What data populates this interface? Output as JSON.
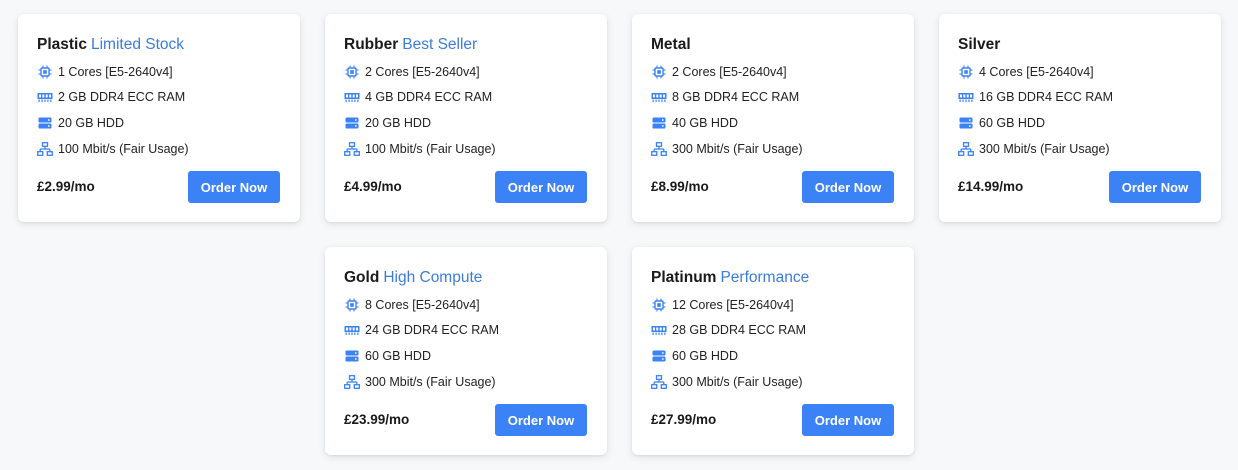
{
  "accent_color": "#3b82f6",
  "tag_color": "#3b7ddd",
  "plans": [
    {
      "name": "Plastic",
      "tag": "Limited Stock",
      "cpu": "1 Cores [E5-2640v4]",
      "ram": "2 GB DDR4 ECC RAM",
      "disk": "20 GB HDD",
      "network": "100 Mbit/s (Fair Usage)",
      "price": "£2.99/mo",
      "button": "Order Now"
    },
    {
      "name": "Rubber",
      "tag": "Best Seller",
      "cpu": "2 Cores [E5-2640v4]",
      "ram": "4 GB DDR4 ECC RAM",
      "disk": "20 GB HDD",
      "network": "100 Mbit/s (Fair Usage)",
      "price": "£4.99/mo",
      "button": "Order Now"
    },
    {
      "name": "Metal",
      "tag": "",
      "cpu": "2 Cores [E5-2640v4]",
      "ram": "8 GB DDR4 ECC RAM",
      "disk": "40 GB HDD",
      "network": "300 Mbit/s (Fair Usage)",
      "price": "£8.99/mo",
      "button": "Order Now"
    },
    {
      "name": "Silver",
      "tag": "",
      "cpu": "4 Cores [E5-2640v4]",
      "ram": "16 GB DDR4 ECC RAM",
      "disk": "60 GB HDD",
      "network": "300 Mbit/s (Fair Usage)",
      "price": "£14.99/mo",
      "button": "Order Now"
    },
    {
      "name": "Gold",
      "tag": "High Compute",
      "cpu": "8 Cores [E5-2640v4]",
      "ram": "24 GB DDR4 ECC RAM",
      "disk": "60 GB HDD",
      "network": "300 Mbit/s (Fair Usage)",
      "price": "£23.99/mo",
      "button": "Order Now"
    },
    {
      "name": "Platinum",
      "tag": "Performance",
      "cpu": "12 Cores [E5-2640v4]",
      "ram": "28 GB DDR4 ECC RAM",
      "disk": "60 GB HDD",
      "network": "300 Mbit/s (Fair Usage)",
      "price": "£27.99/mo",
      "button": "Order Now"
    }
  ],
  "icons": {
    "cpu": "cpu-chip-icon",
    "ram": "memory-icon",
    "disk": "hard-drive-icon",
    "network": "network-icon"
  }
}
